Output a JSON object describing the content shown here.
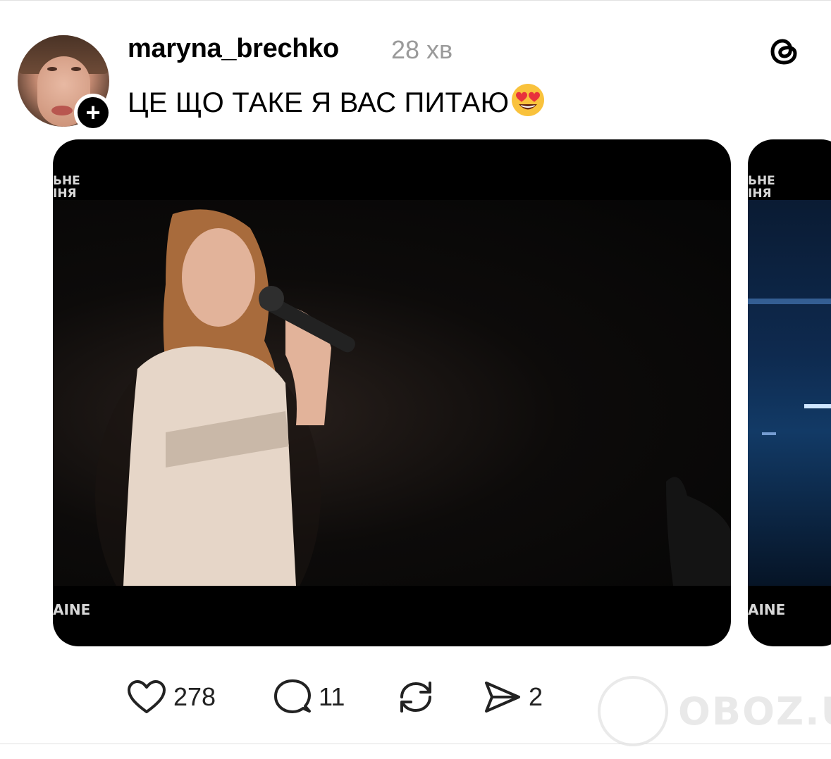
{
  "post": {
    "username": "maryna_brechko",
    "time": "28 хв",
    "text": "ЦЕ ЩО ТАКЕ Я ВАС ПИТАЮ",
    "emoji": "heart-eyes-emoji"
  },
  "media": {
    "overlay_top": [
      "ЬНЕ",
      "ІНЯ"
    ],
    "overlay_bottom": "AINE"
  },
  "media2": {
    "overlay_top": [
      "ЬНЕ",
      "ІНЯ"
    ],
    "overlay_bottom": "AINE"
  },
  "actions": {
    "likes": "278",
    "comments": "11",
    "shares": "2"
  },
  "watermark": "OBOZ.UA",
  "icons": [
    "threads-logo-icon",
    "plus-icon",
    "heart-icon",
    "comment-icon",
    "repost-icon",
    "share-icon"
  ]
}
